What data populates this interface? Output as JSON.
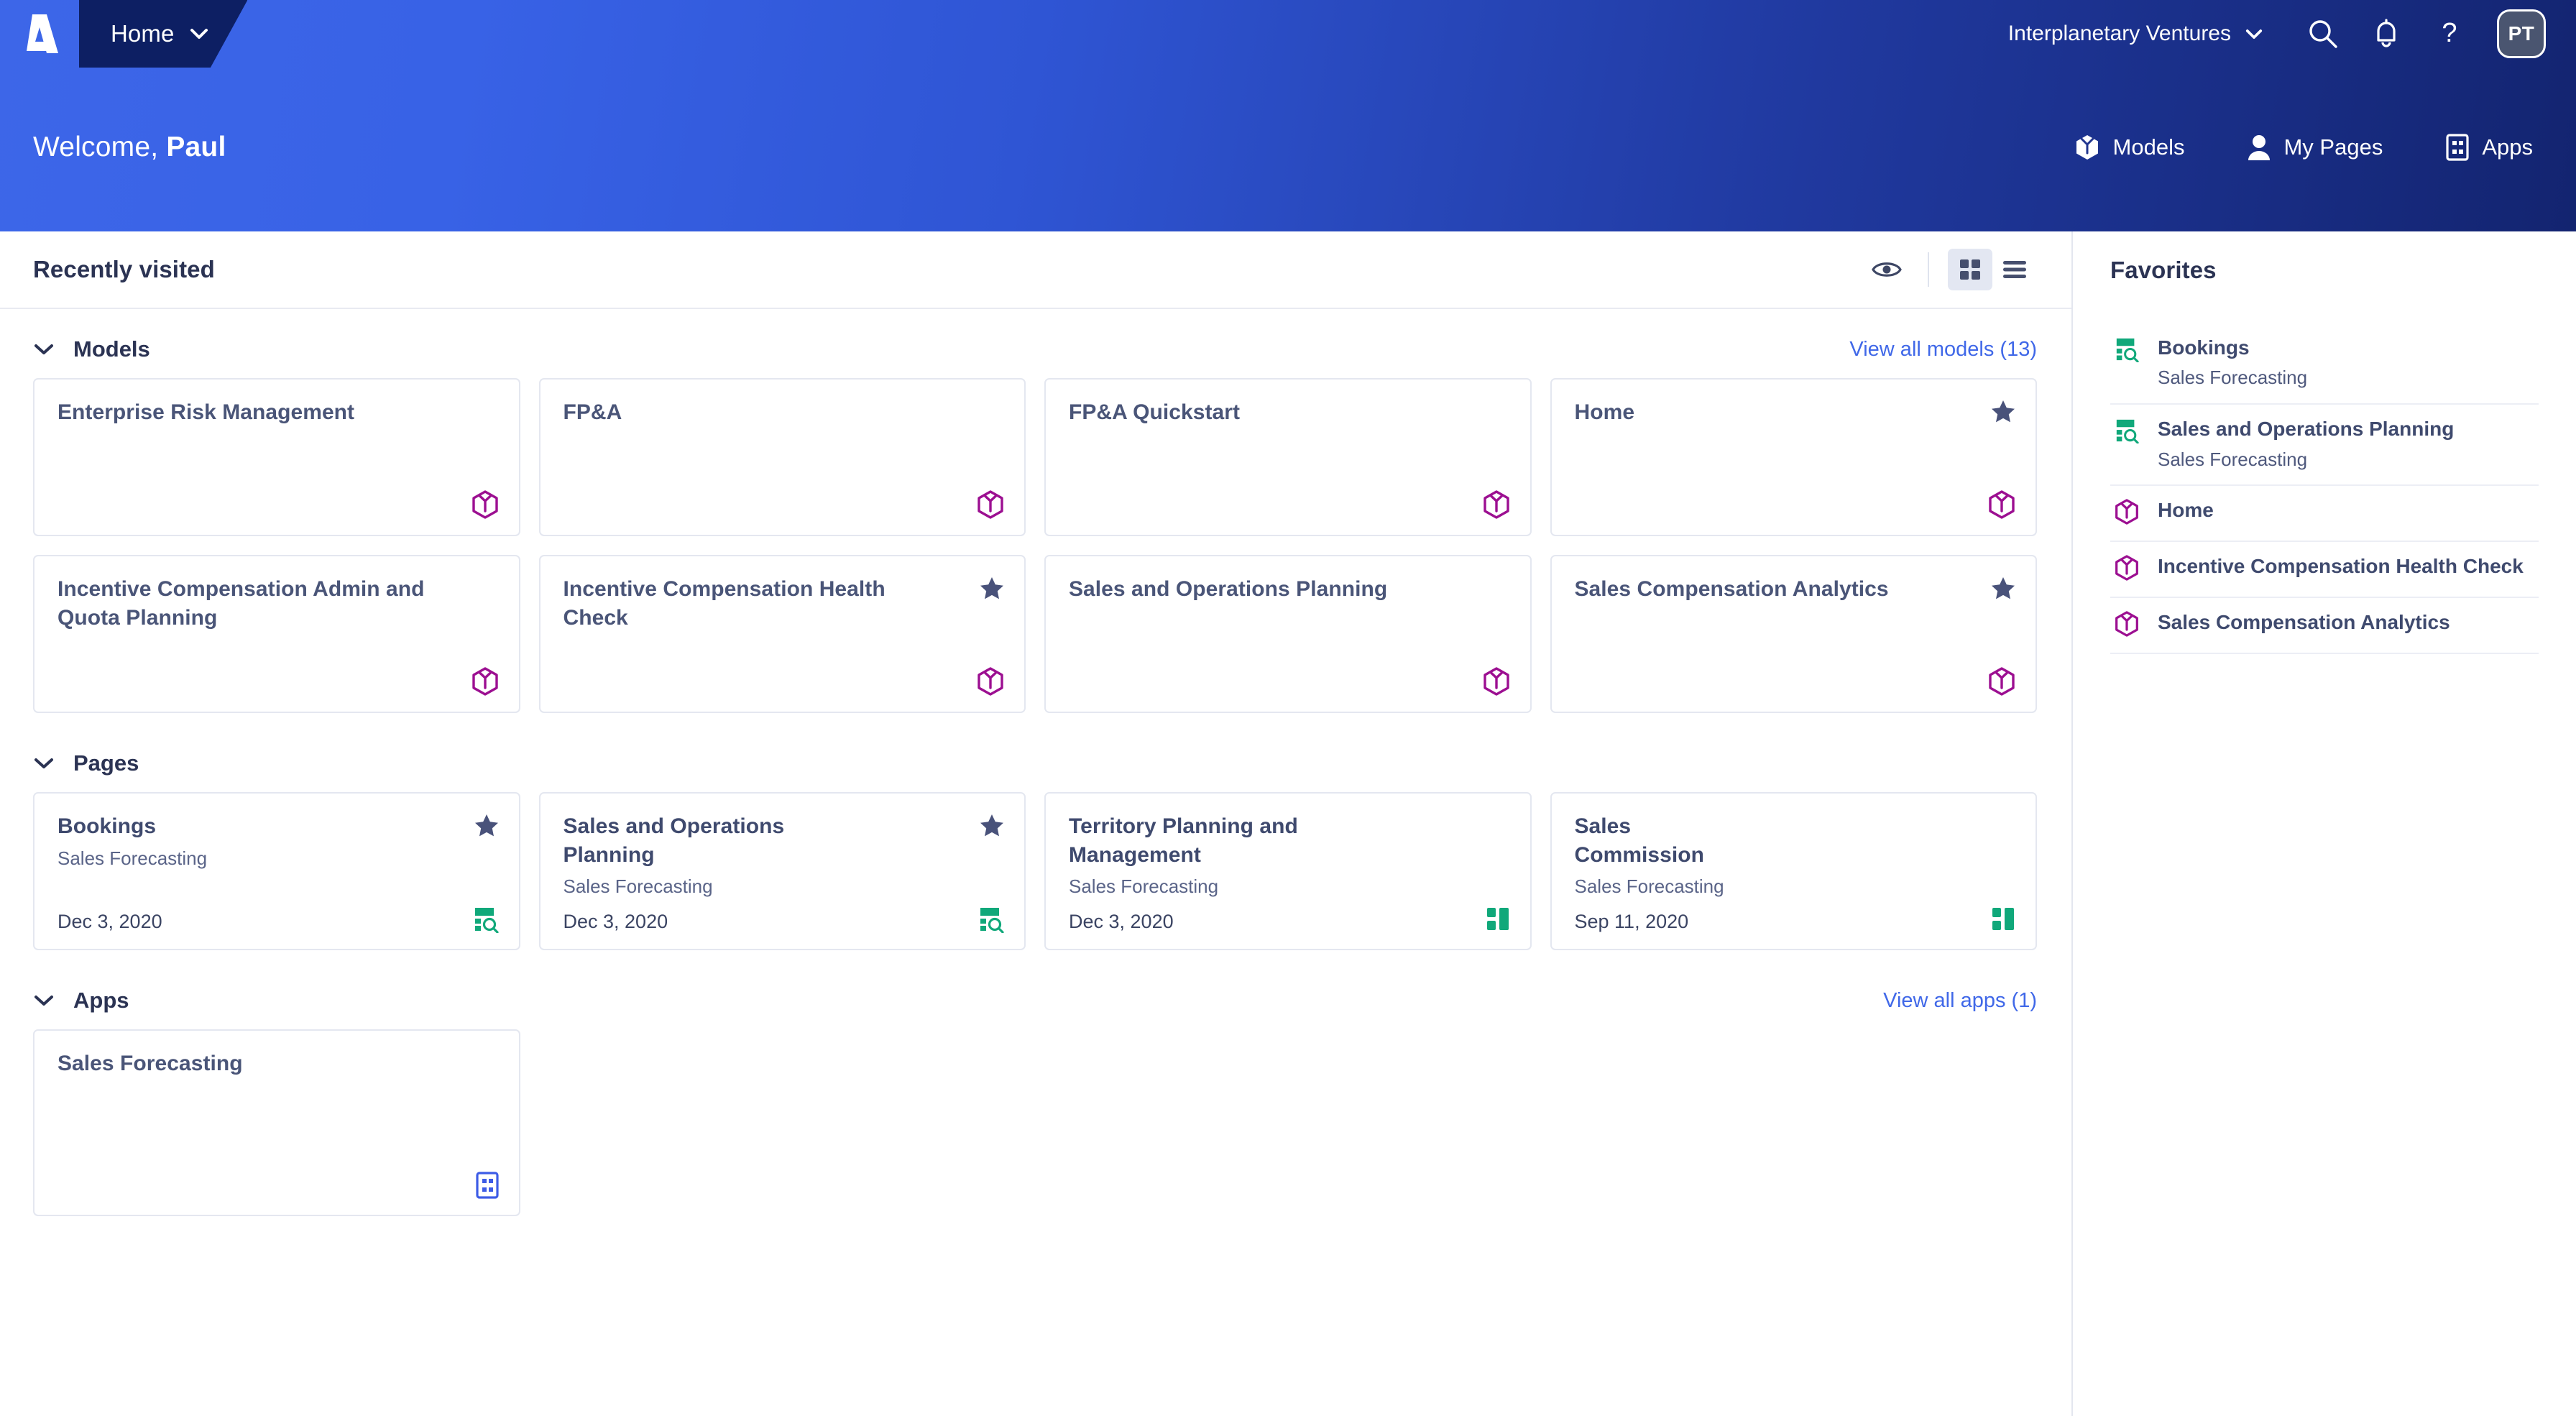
{
  "topbar": {
    "logo_icon": "anaplan-logo-icon",
    "home_tab_label": "Home",
    "tenant_label": "Interplanetary Ventures",
    "search_icon": "search-icon",
    "notifications_icon": "bell-icon",
    "help_icon": "question-mark-icon",
    "avatar_initials": "PT"
  },
  "banner": {
    "welcome_prefix": "Welcome, ",
    "welcome_name": "Paul",
    "nav": [
      {
        "label": "Models",
        "icon": "cube-icon"
      },
      {
        "label": "My Pages",
        "icon": "person-icon"
      },
      {
        "label": "Apps",
        "icon": "app-grid-icon"
      }
    ],
    "gradient_start": "#3d66e8",
    "gradient_end": "#132470"
  },
  "recently_visited": {
    "title": "Recently visited",
    "eye_icon": "eye-icon",
    "grid_view_icon": "grid-view-icon",
    "list_view_icon": "list-view-icon",
    "active_view": "grid"
  },
  "sections": {
    "models": {
      "title": "Models",
      "view_all_label": "View all models (13)",
      "cards": [
        {
          "title": "Enterprise Risk Management",
          "starred": false,
          "icon": "model-cube-icon"
        },
        {
          "title": "FP&A",
          "starred": false,
          "icon": "model-cube-icon"
        },
        {
          "title": "FP&A Quickstart",
          "starred": false,
          "icon": "model-cube-icon"
        },
        {
          "title": "Home",
          "starred": true,
          "icon": "model-cube-icon"
        },
        {
          "title": "Incentive Compensation Admin and Quota Planning",
          "starred": false,
          "icon": "model-cube-icon"
        },
        {
          "title": "Incentive Compensation Health Check",
          "starred": true,
          "icon": "model-cube-icon"
        },
        {
          "title": "Sales and Operations Planning",
          "starred": false,
          "icon": "model-cube-icon"
        },
        {
          "title": "Sales Compensation Analytics",
          "starred": true,
          "icon": "model-cube-icon"
        }
      ]
    },
    "pages": {
      "title": "Pages",
      "cards": [
        {
          "title": "Bookings",
          "subtitle": "Sales Forecasting",
          "date": "Dec 3, 2020",
          "starred": true,
          "icon": "report-page-icon"
        },
        {
          "title": "Sales and Operations Planning",
          "subtitle": "Sales Forecasting",
          "date": "Dec 3, 2020",
          "starred": true,
          "icon": "report-page-icon"
        },
        {
          "title": "Territory Planning and Management",
          "subtitle": "Sales Forecasting",
          "date": "Dec 3, 2020",
          "starred": false,
          "icon": "board-page-icon"
        },
        {
          "title": "Sales Commission",
          "subtitle": "Sales Forecasting",
          "date": "Sep 11, 2020",
          "starred": false,
          "icon": "board-page-icon"
        }
      ]
    },
    "apps": {
      "title": "Apps",
      "view_all_label": "View all apps (1)",
      "cards": [
        {
          "title": "Sales Forecasting",
          "icon": "app-grid-icon"
        }
      ]
    }
  },
  "favorites": {
    "title": "Favorites",
    "items": [
      {
        "name": "Bookings",
        "subtitle": "Sales Forecasting",
        "icon": "report-page-icon",
        "kind": "page"
      },
      {
        "name": "Sales and Operations Planning",
        "subtitle": "Sales Forecasting",
        "icon": "report-page-icon",
        "kind": "page"
      },
      {
        "name": "Home",
        "subtitle": "",
        "icon": "model-cube-icon",
        "kind": "model"
      },
      {
        "name": "Incentive Compensation Health Check",
        "subtitle": "",
        "icon": "model-cube-icon",
        "kind": "model"
      },
      {
        "name": "Sales Compensation Analytics",
        "subtitle": "",
        "icon": "model-cube-icon",
        "kind": "model"
      }
    ]
  },
  "colors": {
    "brand_blue": "#2f55d4",
    "link_blue": "#4068e8",
    "model_purple": "#9c0f91",
    "page_green": "#10a87a",
    "app_blue": "#3d5ce6",
    "text_navy": "#2b3353"
  }
}
